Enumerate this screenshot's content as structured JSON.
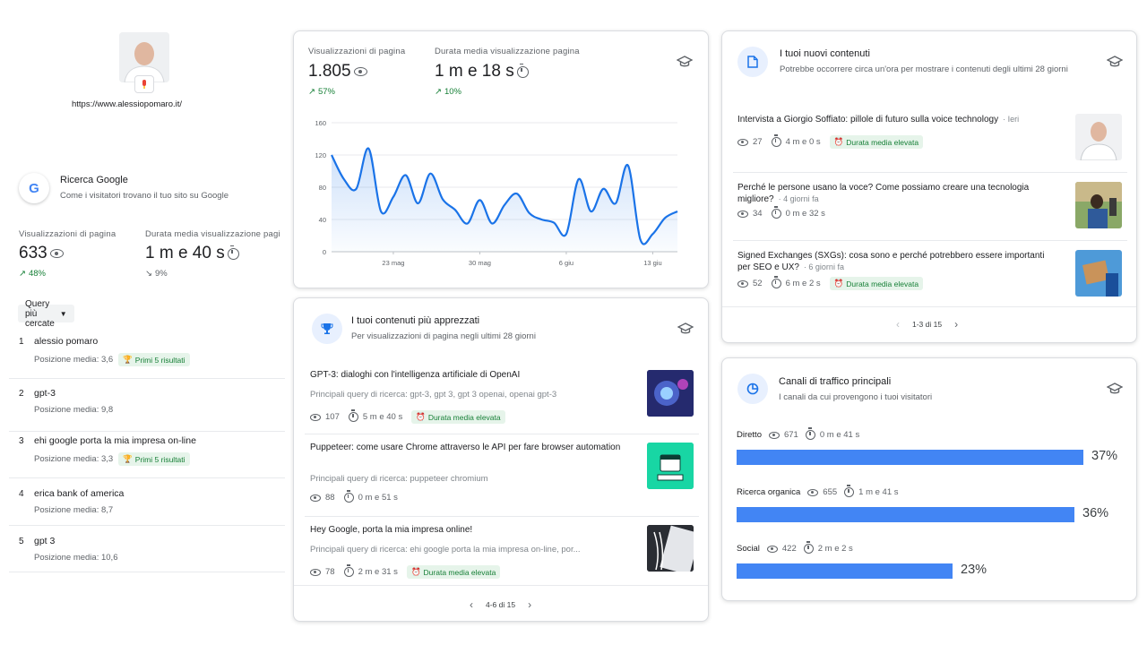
{
  "site": {
    "url": "https://www.alessiopomaro.it/"
  },
  "left": {
    "title": "Ricerca Google",
    "subtitle": "Come i visitatori trovano il tuo sito su Google",
    "icon": "google-g-icon",
    "metrics": [
      {
        "label": "Visualizzazioni di pagina",
        "value": "633",
        "delta": "48%",
        "trend": "up"
      },
      {
        "label": "Durata media visualizzazione pagi",
        "value": "1 m e 40 s",
        "delta": "9%",
        "trend": "down"
      }
    ],
    "dropdown_label": "Query più cercate",
    "queries": [
      {
        "rank": "1",
        "text": "alessio pomaro",
        "position": "Posizione media: 3,6",
        "badge": "Primi 5 risultati"
      },
      {
        "rank": "2",
        "text": "gpt-3",
        "position": "Posizione media: 9,8",
        "badge": ""
      },
      {
        "rank": "3",
        "text": "ehi google porta la mia impresa on-line",
        "position": "Posizione media: 3,3",
        "badge": "Primi 5 risultati"
      },
      {
        "rank": "4",
        "text": "erica bank of america",
        "position": "Posizione media: 8,7",
        "badge": ""
      },
      {
        "rank": "5",
        "text": "gpt 3",
        "position": "Posizione media: 10,6",
        "badge": ""
      }
    ]
  },
  "overview": {
    "metrics": [
      {
        "label": "Visualizzazioni di pagina",
        "value": "1.805",
        "delta": "57%"
      },
      {
        "label": "Durata media visualizzazione pagina",
        "value": "1 m e 18 s",
        "delta": "10%"
      }
    ]
  },
  "chart_data": {
    "type": "line",
    "title": "",
    "xlabel": "",
    "ylabel": "",
    "ylim": [
      0,
      160
    ],
    "y_ticks": [
      "0",
      "40",
      "80",
      "120",
      "160"
    ],
    "x_tick_labels": [
      "23 mag",
      "30 mag",
      "6 giu",
      "13 giu"
    ],
    "x_tick_index": [
      5,
      12,
      19,
      26
    ],
    "fill": true,
    "color": "#1a73e8",
    "grid": true,
    "series": [
      {
        "values": [
          120,
          90,
          78,
          128,
          50,
          68,
          95,
          60,
          97,
          65,
          52,
          35,
          64,
          35,
          58,
          72,
          48,
          40,
          36,
          22,
          90,
          50,
          78,
          60,
          107,
          15,
          22,
          42,
          50
        ]
      }
    ]
  },
  "popular": {
    "title": "I tuoi contenuti più apprezzati",
    "subtitle": "Per visualizzazioni di pagina negli ultimi 28 giorni",
    "items": [
      {
        "title": "GPT-3: dialoghi con l'intelligenza artificiale di OpenAI",
        "query": "Principali query di ricerca: gpt-3, gpt 3, gpt 3 openai, openai gpt-3",
        "views": "107",
        "duration": "5 m e 40 s",
        "badge": "Durata media elevata",
        "thumb_color": "#2b2f7a"
      },
      {
        "title": "Puppeteer: come usare Chrome attraverso le API per fare browser automation",
        "query": "Principali query di ricerca: puppeteer chromium",
        "views": "88",
        "duration": "0 m e 51 s",
        "badge": "",
        "thumb_color": "#16d4a2"
      },
      {
        "title": "Hey Google, porta la mia impresa online!",
        "query": "Principali query di ricerca: ehi google porta la mia impresa on-line, por...",
        "views": "78",
        "duration": "2 m e 31 s",
        "badge": "Durata media elevata",
        "thumb_color": "#2a2d33"
      }
    ],
    "pager": "4-6 di 15"
  },
  "new_content": {
    "title": "I tuoi nuovi contenuti",
    "subtitle": "Potrebbe occorrere circa un'ora per mostrare i contenuti degli ultimi 28 giorni",
    "items": [
      {
        "title": "Intervista a Giorgio Soffiato: pillole di futuro sulla voice technology",
        "date": "· Ieri",
        "views": "27",
        "duration": "4 m e 0 s",
        "badge": "Durata media elevata"
      },
      {
        "title": "Perché le persone usano la voce? Come possiamo creare una tecnologia migliore?",
        "date": "· 4 giorni fa",
        "views": "34",
        "duration": "0 m e 32 s",
        "badge": ""
      },
      {
        "title": "Signed Exchanges (SXGs): cosa sono e perché potrebbero essere importanti per SEO e UX?",
        "date": "· 6 giorni fa",
        "views": "52",
        "duration": "6 m e 2 s",
        "badge": "Durata media elevata"
      }
    ],
    "pager": "1-3 di 15"
  },
  "traffic": {
    "title": "Canali di traffico principali",
    "subtitle": "I canali da cui provengono i tuoi visitatori",
    "bar_color": "#4285f4",
    "channels": [
      {
        "name": "Diretto",
        "views": "671",
        "duration": "0 m e 41 s",
        "pct": "37%",
        "share": 0.37
      },
      {
        "name": "Ricerca organica",
        "views": "655",
        "duration": "1 m e 41 s",
        "pct": "36%",
        "share": 0.36
      },
      {
        "name": "Social",
        "views": "422",
        "duration": "2 m e 2 s",
        "pct": "23%",
        "share": 0.23
      }
    ]
  }
}
